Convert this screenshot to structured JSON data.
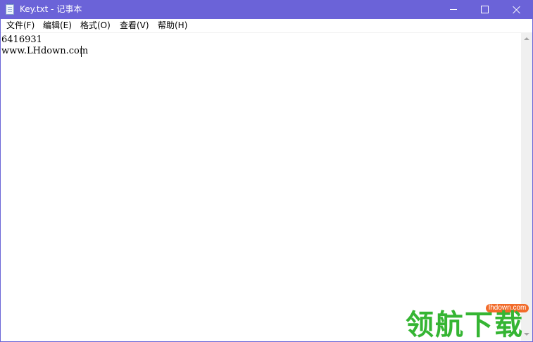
{
  "window": {
    "title": "Key.txt - 记事本",
    "accent_color": "#6b63d8"
  },
  "menu": {
    "items": [
      {
        "label": "文件(F)"
      },
      {
        "label": "编辑(E)"
      },
      {
        "label": "格式(O)"
      },
      {
        "label": "查看(V)"
      },
      {
        "label": "帮助(H)"
      }
    ]
  },
  "editor": {
    "lines": [
      "6416931",
      "www.LHdown.com"
    ]
  },
  "watermark": {
    "url": "lhdown.com",
    "text": "领航下载",
    "color": "#35b533"
  },
  "icons": {
    "app": "notepad-icon",
    "minimize": "minimize-icon",
    "maximize": "maximize-icon",
    "close": "close-icon",
    "scroll_up": "scroll-up-arrow-icon",
    "scroll_down": "scroll-down-arrow-icon"
  }
}
